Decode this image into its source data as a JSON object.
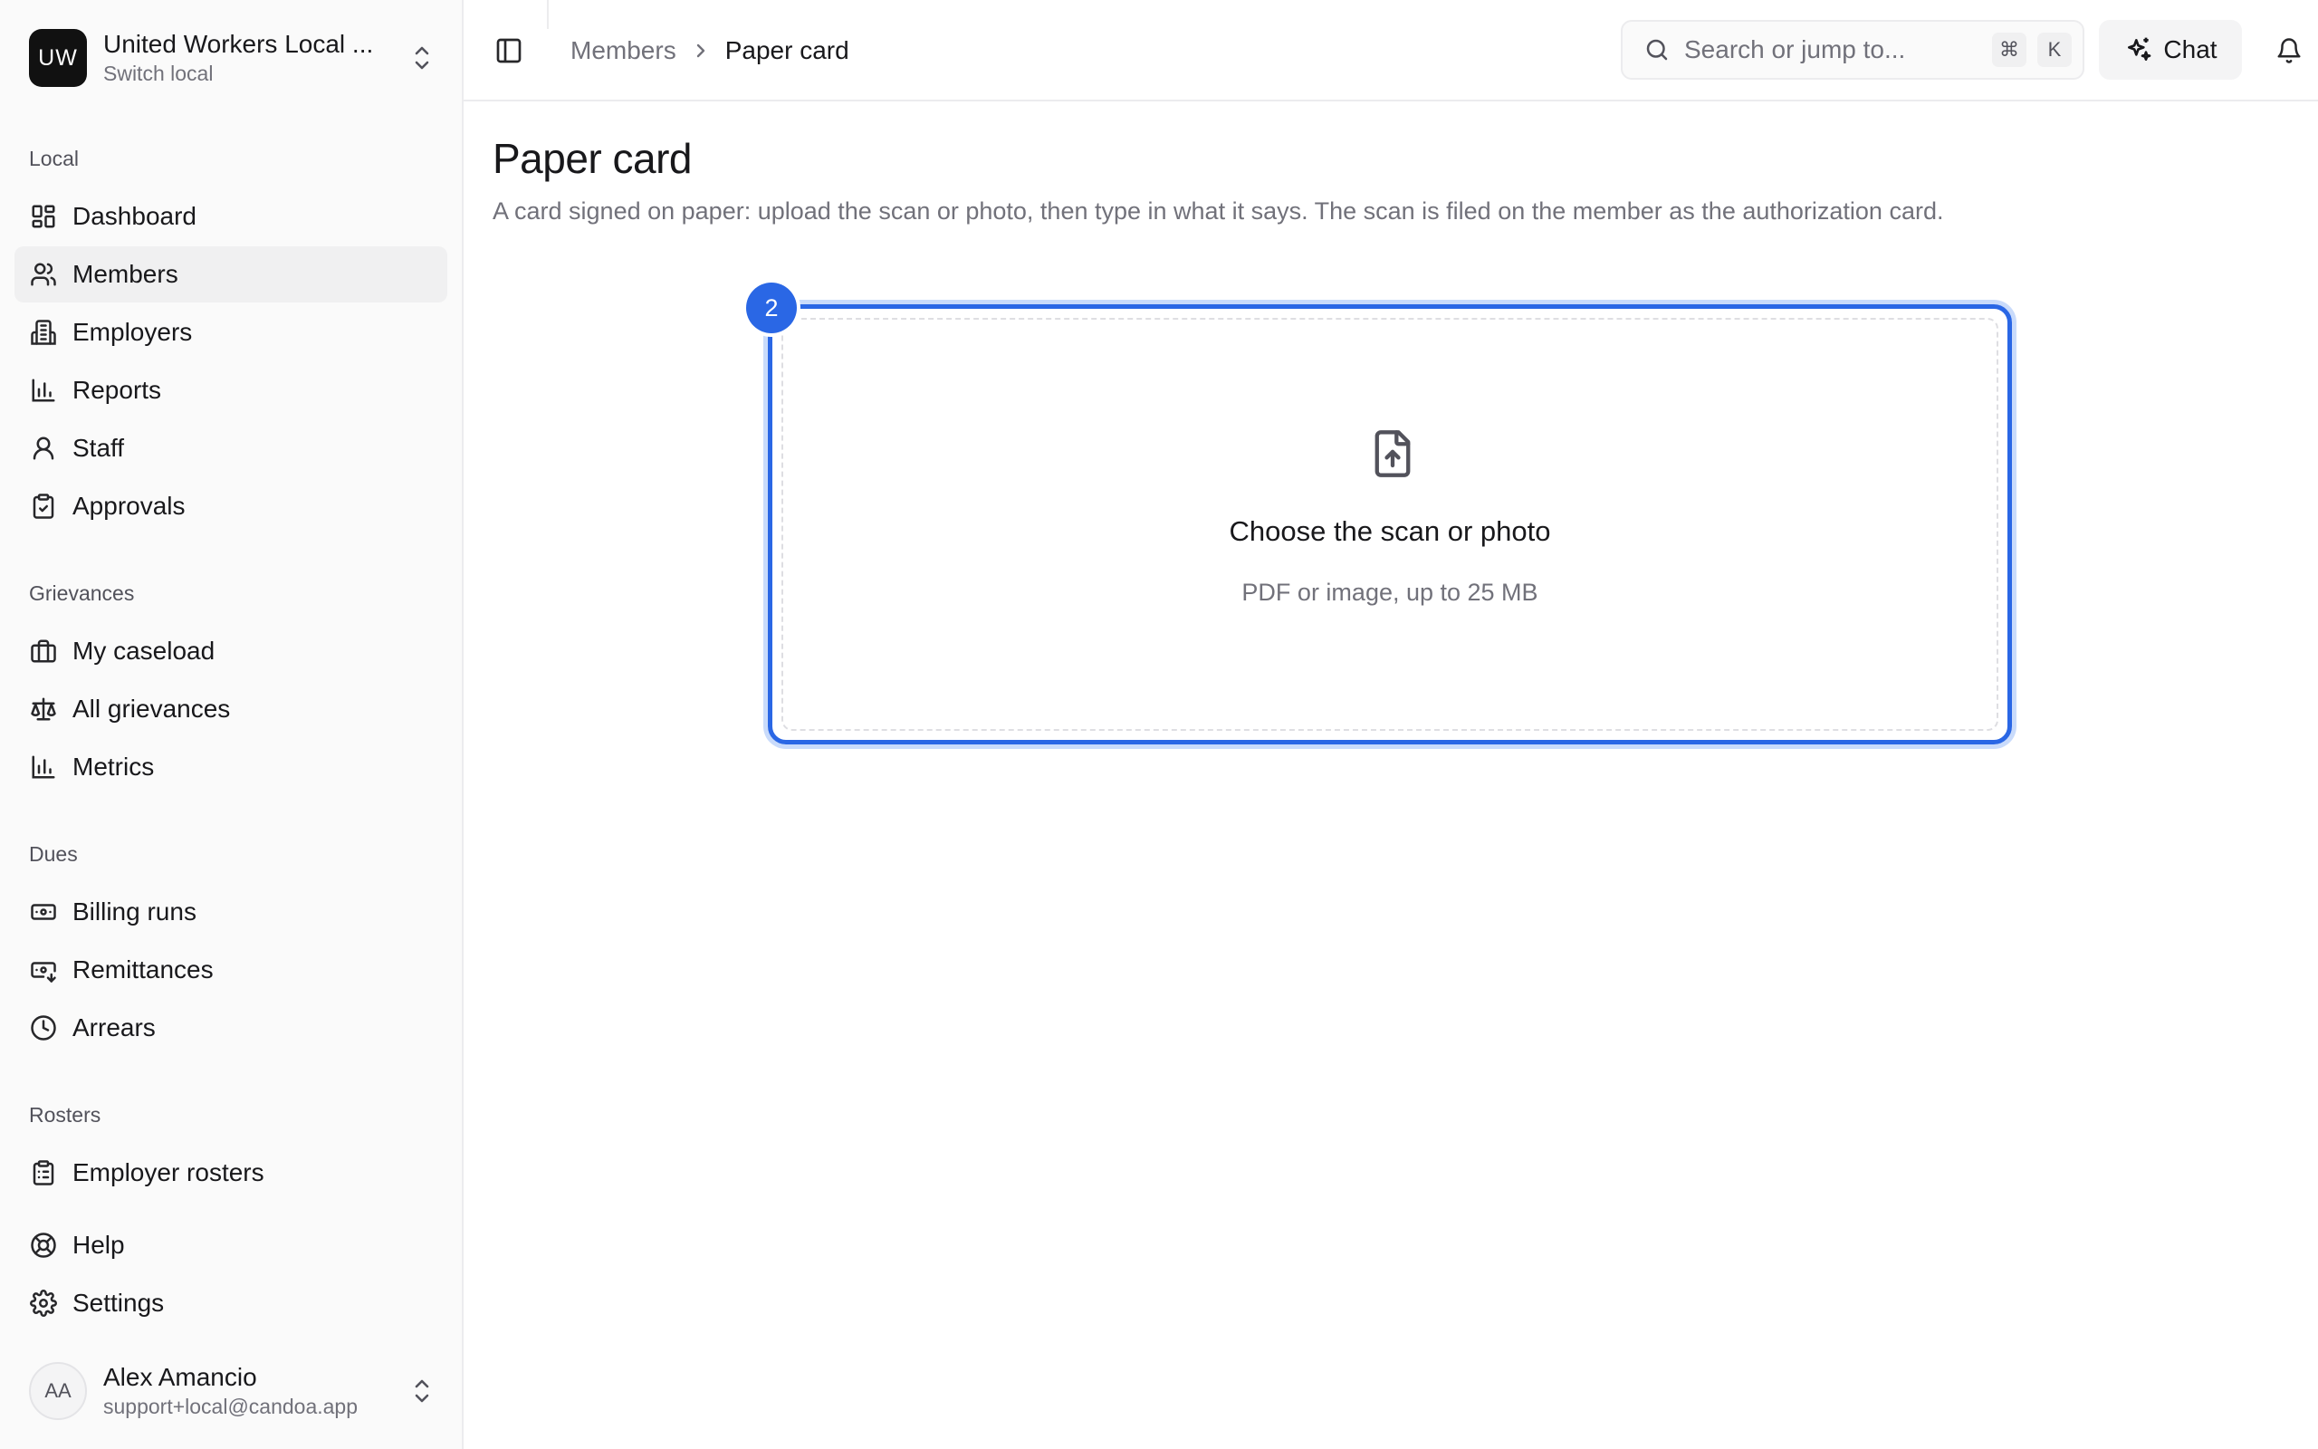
{
  "org": {
    "initials": "UW",
    "name": "United Workers Local ...",
    "switch_label": "Switch local"
  },
  "sidebar": {
    "sections": [
      {
        "label": "Local",
        "items": [
          {
            "label": "Dashboard",
            "icon": "dashboard-icon"
          },
          {
            "label": "Members",
            "icon": "users-icon",
            "active": true
          },
          {
            "label": "Employers",
            "icon": "building-icon"
          },
          {
            "label": "Reports",
            "icon": "bar-chart-icon"
          },
          {
            "label": "Staff",
            "icon": "user-icon"
          },
          {
            "label": "Approvals",
            "icon": "clipboard-check-icon"
          }
        ]
      },
      {
        "label": "Grievances",
        "items": [
          {
            "label": "My caseload",
            "icon": "briefcase-icon"
          },
          {
            "label": "All grievances",
            "icon": "scale-icon"
          },
          {
            "label": "Metrics",
            "icon": "bar-chart-icon"
          }
        ]
      },
      {
        "label": "Dues",
        "items": [
          {
            "label": "Billing runs",
            "icon": "banknote-icon"
          },
          {
            "label": "Remittances",
            "icon": "banknote-arrow-icon"
          },
          {
            "label": "Arrears",
            "icon": "clock-icon"
          }
        ]
      },
      {
        "label": "Rosters",
        "items": [
          {
            "label": "Employer rosters",
            "icon": "clipboard-list-icon"
          }
        ]
      }
    ],
    "footer_items": [
      {
        "label": "Help",
        "icon": "life-buoy-icon"
      },
      {
        "label": "Settings",
        "icon": "gear-icon"
      }
    ]
  },
  "user": {
    "initials": "AA",
    "name": "Alex Amancio",
    "email": "support+local@candoa.app"
  },
  "header": {
    "breadcrumb": [
      "Members",
      "Paper card"
    ],
    "search_placeholder": "Search or jump to...",
    "shortcut_keys": [
      "⌘",
      "K"
    ],
    "chat_label": "Chat"
  },
  "page": {
    "title": "Paper card",
    "description": "A card signed on paper: upload the scan or photo, then type in what it says. The scan is filed on the member as the authorization card."
  },
  "dropzone": {
    "step": "2",
    "title": "Choose the scan or photo",
    "subtitle": "PDF or image, up to 25 MB",
    "accent": "#2a67e5"
  }
}
